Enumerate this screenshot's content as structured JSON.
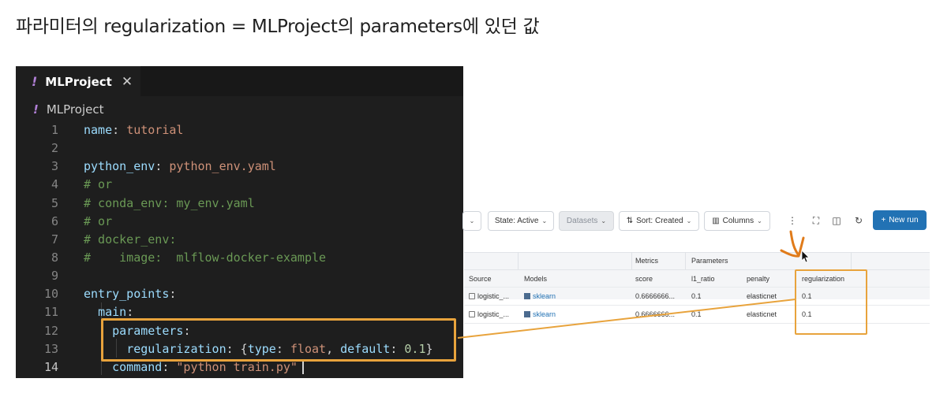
{
  "slide": {
    "title": "파라미터의 regularization = MLProject의 parameters에 있던 값"
  },
  "editor": {
    "tab_label": "MLProject",
    "tab_close_icon": "close-icon",
    "breadcrumb": "MLProject",
    "lines": [
      {
        "n": "1"
      },
      {
        "n": "2"
      },
      {
        "n": "3"
      },
      {
        "n": "4"
      },
      {
        "n": "5"
      },
      {
        "n": "6"
      },
      {
        "n": "7"
      },
      {
        "n": "8"
      },
      {
        "n": "9"
      },
      {
        "n": "10"
      },
      {
        "n": "11"
      },
      {
        "n": "12"
      },
      {
        "n": "13"
      },
      {
        "n": "14"
      }
    ],
    "code": {
      "l1_key": "name",
      "l1_val": "tutorial",
      "l3_key": "python_env",
      "l3_val": "python_env.yaml",
      "l4": "# or",
      "l5": "# conda_env: my_env.yaml",
      "l6": "# or",
      "l7": "# docker_env:",
      "l8": "#    image:  mlflow-docker-example",
      "l10_key": "entry_points",
      "l11_key": "main",
      "l12_key": "parameters",
      "l13_key": "regularization",
      "l13_type_key": "type",
      "l13_type_val": "float",
      "l13_default_key": "default",
      "l13_default_val": "0.1",
      "l14_key": "command",
      "l14_val": "\"python train.py\""
    },
    "colors": {
      "background": "#1e1e1e",
      "highlight": "#e8a33c"
    }
  },
  "mlflow": {
    "toolbar": {
      "state_label": "State: Active",
      "datasets_label": "Datasets",
      "sort_label": "Sort: Created",
      "columns_label": "Columns",
      "new_run_label": "New run"
    },
    "group_headers": {
      "metrics": "Metrics",
      "parameters": "Parameters"
    },
    "columns": [
      "Source",
      "Models",
      "score",
      "l1_ratio",
      "penalty",
      "regularization"
    ],
    "rows": [
      {
        "source": "logistic_...",
        "model": "sklearn",
        "score": "0.6666666...",
        "l1_ratio": "0.1",
        "penalty": "elasticnet",
        "regularization": "0.1"
      },
      {
        "source": "logistic_...",
        "model": "sklearn",
        "score": "0.6666666...",
        "l1_ratio": "0.1",
        "penalty": "elasticnet",
        "regularization": "0.1"
      }
    ],
    "colors": {
      "primary": "#2272b4"
    }
  }
}
